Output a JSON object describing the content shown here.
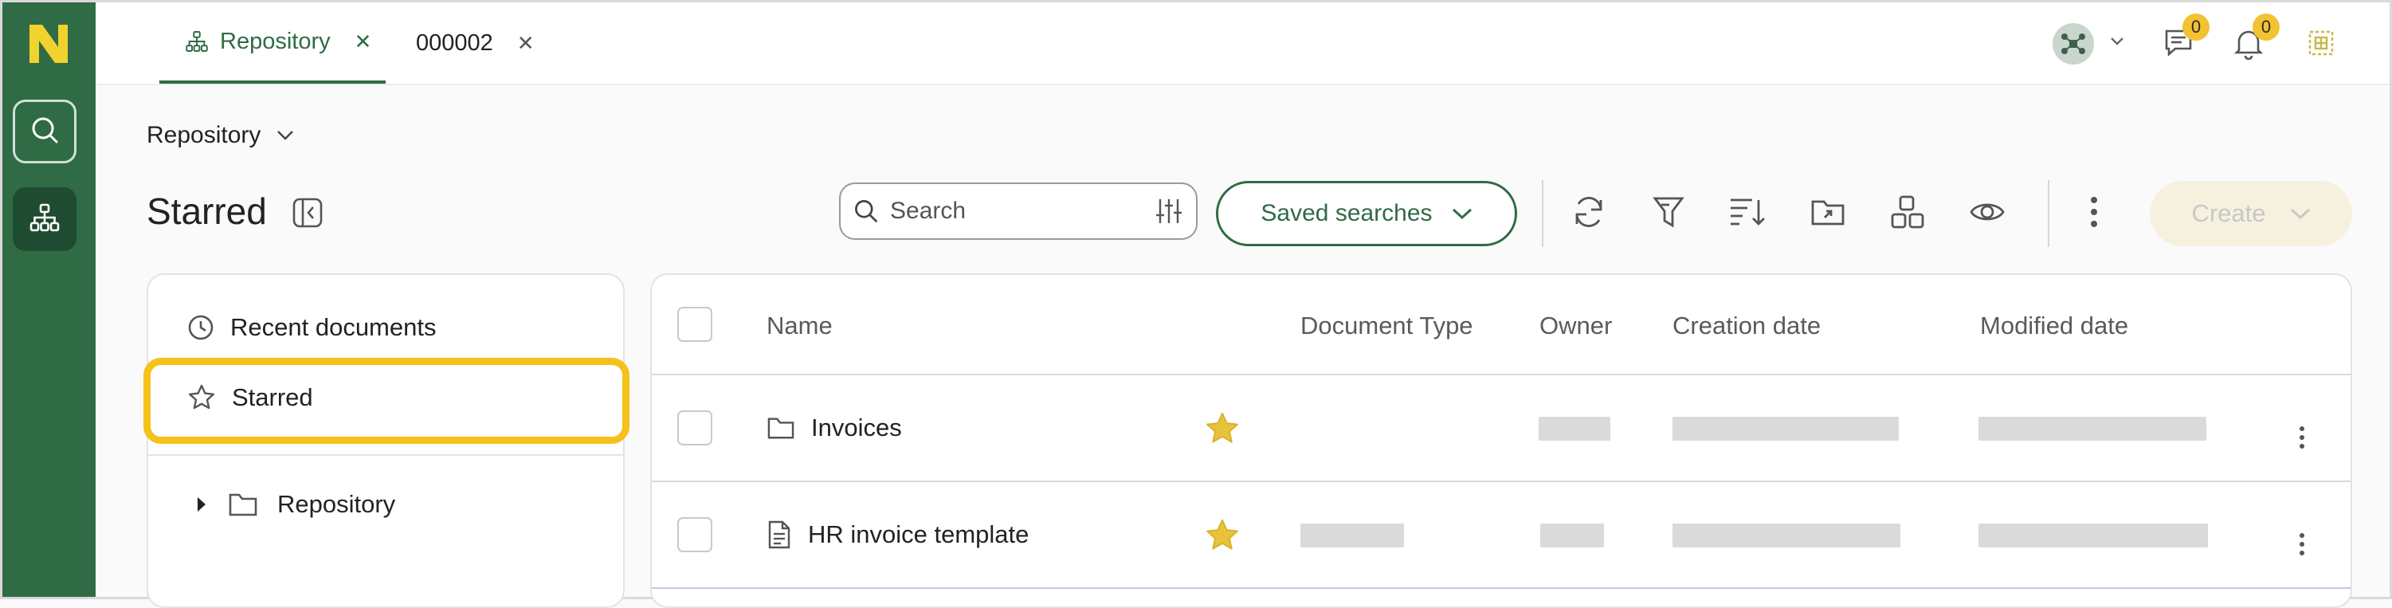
{
  "tabs": [
    {
      "label": "Repository",
      "icon": "sitemap-icon",
      "active": true
    },
    {
      "label": "000002",
      "active": false
    }
  ],
  "notifications": {
    "messages_count": "0",
    "alerts_count": "0"
  },
  "breadcrumb": {
    "label": "Repository"
  },
  "page": {
    "title": "Starred"
  },
  "toolbar": {
    "search_placeholder": "Search",
    "saved_searches_label": "Saved searches",
    "create_label": "Create"
  },
  "sidebar": {
    "items": [
      {
        "label": "Recent documents",
        "icon": "clock-icon"
      },
      {
        "label": "Starred",
        "icon": "star-outline-icon",
        "selected": true
      },
      {
        "label": "Repository",
        "icon": "folder-icon"
      }
    ]
  },
  "table": {
    "columns": [
      "Name",
      "Document Type",
      "Owner",
      "Creation date",
      "Modified date"
    ],
    "rows": [
      {
        "name": "Invoices",
        "kind": "folder",
        "starred": true
      },
      {
        "name": "HR invoice template",
        "kind": "document",
        "starred": true
      }
    ]
  },
  "colors": {
    "brand_green": "#2f6b45",
    "highlight_yellow": "#f5c11b",
    "star_gold": "#e8c23a"
  }
}
